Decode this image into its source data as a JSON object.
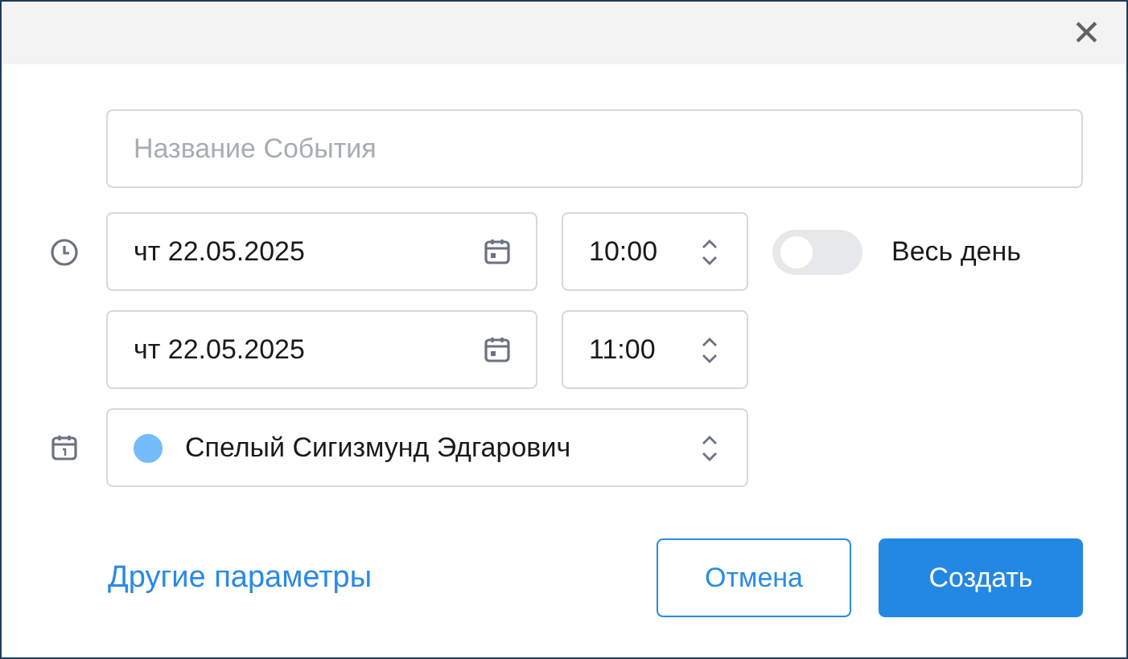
{
  "close_button": {
    "label": "✕"
  },
  "title_field": {
    "placeholder": "Название События"
  },
  "start": {
    "date": "чт 22.05.2025",
    "time": "10:00"
  },
  "end": {
    "date": "чт 22.05.2025",
    "time": "11:00"
  },
  "all_day": {
    "label": "Весь день",
    "on": false
  },
  "calendar": {
    "name": "Спелый Сигизмунд Эдгарович",
    "color": "#74bcfb"
  },
  "more_link": "Другие параметры",
  "buttons": {
    "cancel": "Отмена",
    "create": "Создать"
  }
}
